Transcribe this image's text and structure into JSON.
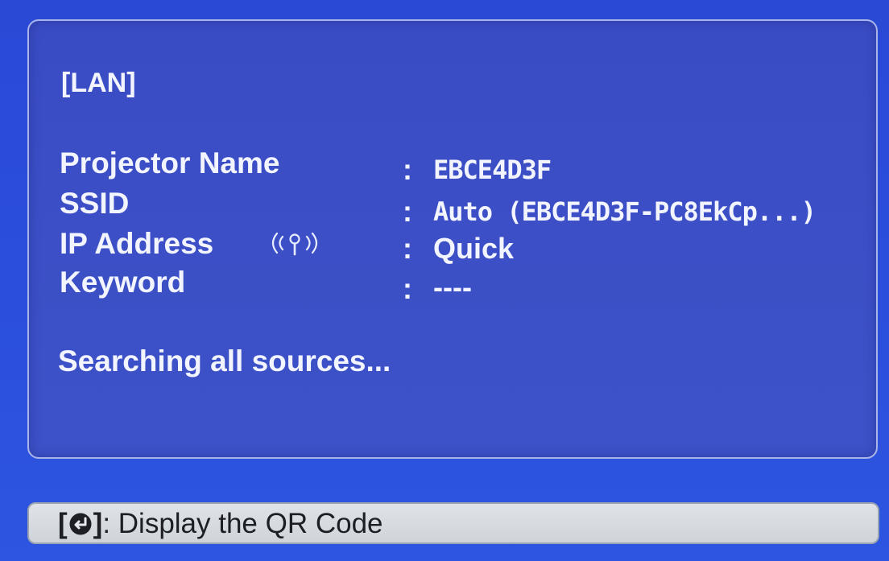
{
  "section": {
    "title": "[LAN]"
  },
  "info": {
    "rows": [
      {
        "label": "Projector Name",
        "colon": ":",
        "value": "EBCE4D3F"
      },
      {
        "label": "SSID",
        "colon": ":",
        "value": "Auto (EBCE4D3F-PC8EkCp...)"
      },
      {
        "label": "IP Address",
        "colon": ":",
        "value": "Quick"
      },
      {
        "label": "Keyword",
        "colon": ":",
        "value": "----"
      }
    ],
    "ip_icon": "wireless-signal-icon"
  },
  "status": {
    "text": "Searching all sources..."
  },
  "help": {
    "open_bracket": "[",
    "close_bracket": "]",
    "text": ": Display the QR Code",
    "icon": "enter-button-icon"
  },
  "colors": {
    "background": "#2b4fdc",
    "panel": "#3c4fc6",
    "panel_border": "#a9b4e8",
    "text": "#f2f4ff",
    "help_bar": "#d8dce1",
    "help_text": "#1d1f24"
  }
}
